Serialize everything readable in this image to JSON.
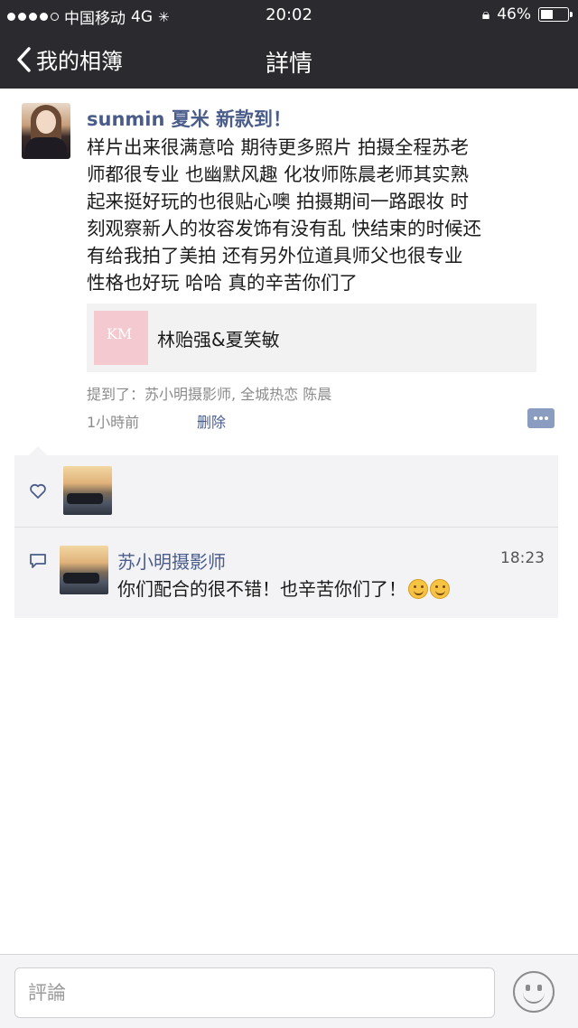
{
  "status_bar": {
    "carrier": "中国移动",
    "network": "4G",
    "time": "20:02",
    "battery": "46%",
    "battery_level": 0.46
  },
  "nav": {
    "back_label": "我的相簿",
    "title": "詳情"
  },
  "post": {
    "username": "sunmin 夏米 新款到！",
    "content": "样片出来很满意哈 期待更多照片 拍摄全程苏老\n师都很专业 也幽默风趣 化妆师陈晨老师其实熟\n起来挺好玩的也很贴心噢 拍摄期间一路跟妆 时\n刻观察新人的妆容发饰有没有乱 快结束的时候还\n有给我拍了美拍 还有另外位道具师父也很专业\n性格也好玩 哈哈 真的辛苦你们了",
    "link_card": {
      "title": "林贻强&夏笑敏",
      "thumb_mark": "KM"
    },
    "mentions": "提到了：苏小明摄影师, 全城热恋 陈晨",
    "time": "1小時前",
    "delete_label": "删除"
  },
  "comment": {
    "name": "苏小明摄影师",
    "time": "18:23",
    "text": "你们配合的很不错！也辛苦你们了！"
  },
  "input": {
    "placeholder": "評論"
  },
  "colors": {
    "header_bg": "#2b2b2f",
    "link_blue": "#4a5d8a",
    "panel_bg": "#f3f3f5"
  }
}
